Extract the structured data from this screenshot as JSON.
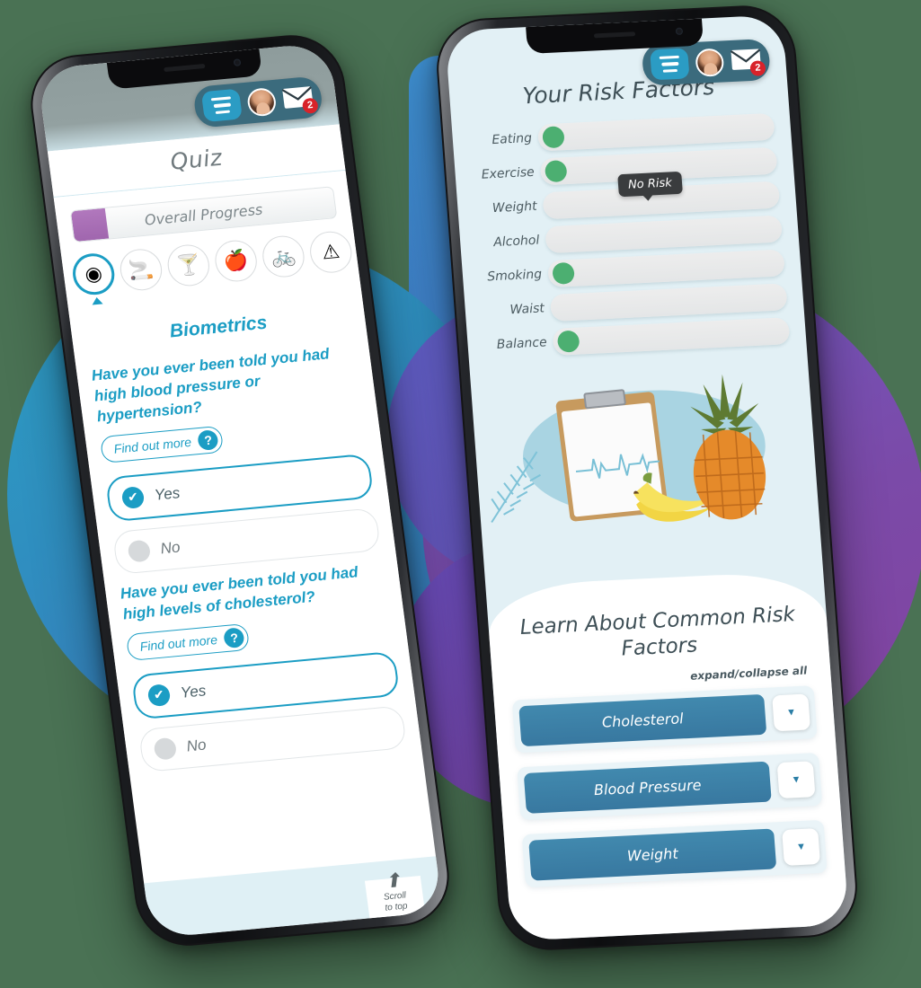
{
  "theme": {
    "page_background": "#4a7254",
    "teal": "#1b9dc4",
    "accordion_blue": "#3878a0",
    "progress_purple": "#a066ae",
    "risk_green": "#4caf71",
    "badge_red": "#d8232a",
    "right_screen_bg": "#e2f0f5"
  },
  "nav": {
    "menu_label": "menu-icon",
    "avatar_label": "user avatar",
    "mail_label": "messages",
    "unread_count": "2"
  },
  "left_phone": {
    "title": "Quiz",
    "progress": {
      "label": "Overall Progress",
      "percent": 13
    },
    "category_icons": [
      {
        "name": "biometrics",
        "glyph": "◉",
        "active": true
      },
      {
        "name": "smoking",
        "glyph": "🚬",
        "active": false
      },
      {
        "name": "alcohol",
        "glyph": "🍸",
        "active": false
      },
      {
        "name": "eating",
        "glyph": "🍎",
        "active": false
      },
      {
        "name": "exercise",
        "glyph": "🚲",
        "active": false
      },
      {
        "name": "risk-warning",
        "glyph": "⚠",
        "active": false
      },
      {
        "name": "more",
        "glyph": "",
        "active": false
      }
    ],
    "section_title": "Biometrics",
    "find_out_more_label": "Find out more",
    "help_glyph": "?",
    "questions": [
      {
        "text": "Have you ever been told you had high blood pressure or hypertension?",
        "options": [
          {
            "label": "Yes",
            "selected": true
          },
          {
            "label": "No",
            "selected": false
          }
        ]
      },
      {
        "text": "Have you ever been told you had high levels of cholesterol?",
        "options": [
          {
            "label": "Yes",
            "selected": true
          },
          {
            "label": "No",
            "selected": false
          }
        ]
      }
    ],
    "scroll_to_top": {
      "line1": "Scroll",
      "line2": "to top",
      "arrow": "⬆"
    }
  },
  "right_phone": {
    "title": "Your Risk Factors",
    "tooltip": "No Risk",
    "risk_factors": [
      {
        "label": "Eating",
        "has_marker": true
      },
      {
        "label": "Exercise",
        "has_marker": true
      },
      {
        "label": "Weight",
        "has_marker": false
      },
      {
        "label": "Alcohol",
        "has_marker": false
      },
      {
        "label": "Smoking",
        "has_marker": true
      },
      {
        "label": "Waist",
        "has_marker": false
      },
      {
        "label": "Balance",
        "has_marker": true
      }
    ],
    "illustration": "clipboard with heartbeat chart, bananas, pineapple and fern leaves",
    "learn_title": "Learn About Common Risk Factors",
    "expand_collapse_label": "expand/collapse all",
    "accordion_items": [
      {
        "label": "Cholesterol",
        "chevron": "▼"
      },
      {
        "label": "Blood Pressure",
        "chevron": "▼"
      },
      {
        "label": "Weight",
        "chevron": "▼"
      }
    ]
  }
}
